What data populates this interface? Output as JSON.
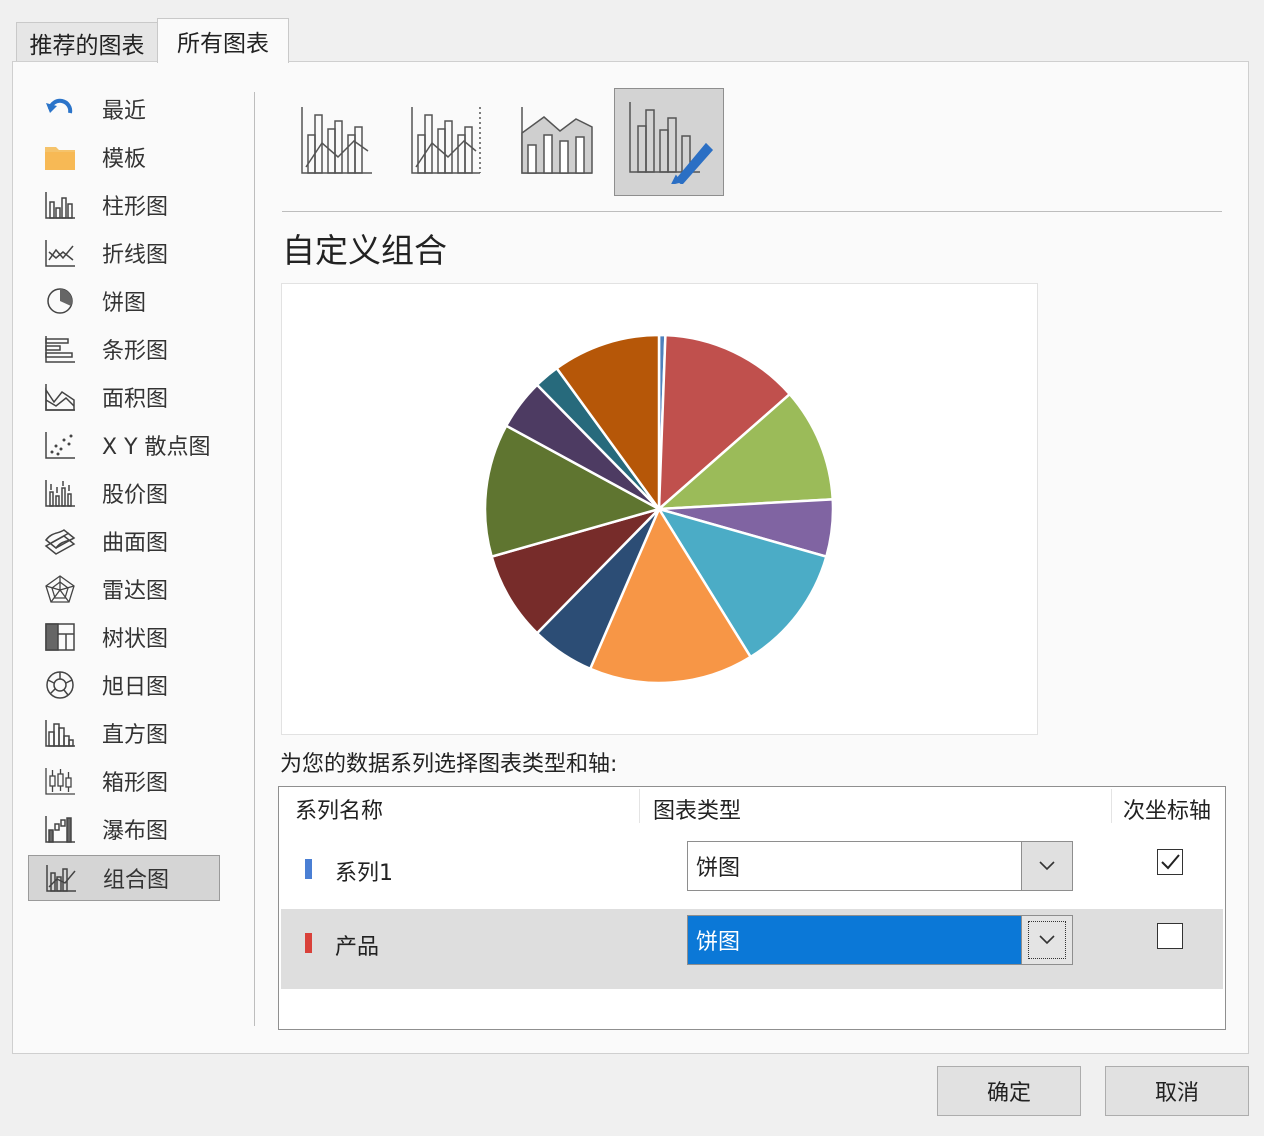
{
  "tabs": [
    "推荐的图表",
    "所有图表"
  ],
  "sidebar": {
    "items": [
      {
        "label": "最近",
        "icon": "undo-arrow-icon"
      },
      {
        "label": "模板",
        "icon": "folder-icon"
      },
      {
        "label": "柱形图",
        "icon": "column-chart-icon"
      },
      {
        "label": "折线图",
        "icon": "line-chart-icon"
      },
      {
        "label": "饼图",
        "icon": "pie-chart-icon"
      },
      {
        "label": "条形图",
        "icon": "bar-chart-icon"
      },
      {
        "label": "面积图",
        "icon": "area-chart-icon"
      },
      {
        "label": "X Y 散点图",
        "icon": "scatter-chart-icon"
      },
      {
        "label": "股价图",
        "icon": "stock-chart-icon"
      },
      {
        "label": "曲面图",
        "icon": "surface-chart-icon"
      },
      {
        "label": "雷达图",
        "icon": "radar-chart-icon"
      },
      {
        "label": "树状图",
        "icon": "treemap-chart-icon"
      },
      {
        "label": "旭日图",
        "icon": "sunburst-chart-icon"
      },
      {
        "label": "直方图",
        "icon": "histogram-chart-icon"
      },
      {
        "label": "箱形图",
        "icon": "box-whisker-chart-icon"
      },
      {
        "label": "瀑布图",
        "icon": "waterfall-chart-icon"
      },
      {
        "label": "组合图",
        "icon": "combo-chart-icon"
      }
    ],
    "selected_index": 16
  },
  "subtypes": [
    "clustered-column-line-icon",
    "clustered-column-line-secondary-axis-icon",
    "stacked-area-clustered-column-icon",
    "custom-combination-icon"
  ],
  "main": {
    "title": "自定义组合",
    "instruction": "为您的数据系列选择图表类型和轴:"
  },
  "chart_data": {
    "type": "pie",
    "values": [
      0.5,
      11,
      9,
      4.5,
      10,
      13,
      5,
      7,
      10.5,
      4,
      2,
      8.5
    ],
    "colors": [
      "#4f81bd",
      "#c0504d",
      "#9bbb59",
      "#8064a2",
      "#4bacc6",
      "#f79646",
      "#2c4d75",
      "#772c2a",
      "#5f7530",
      "#4d3b62",
      "#276a7c",
      "#b65708"
    ]
  },
  "series_table": {
    "headers": [
      "系列名称",
      "图表类型",
      "次坐标轴"
    ],
    "rows": [
      {
        "name": "系列1",
        "chart_type": "饼图",
        "secondary_axis": true,
        "color": "#4a7fd4"
      },
      {
        "name": "产品",
        "chart_type": "饼图",
        "secondary_axis": false,
        "color": "#d9413a"
      }
    ]
  },
  "buttons": {
    "ok": "确定",
    "cancel": "取消"
  }
}
